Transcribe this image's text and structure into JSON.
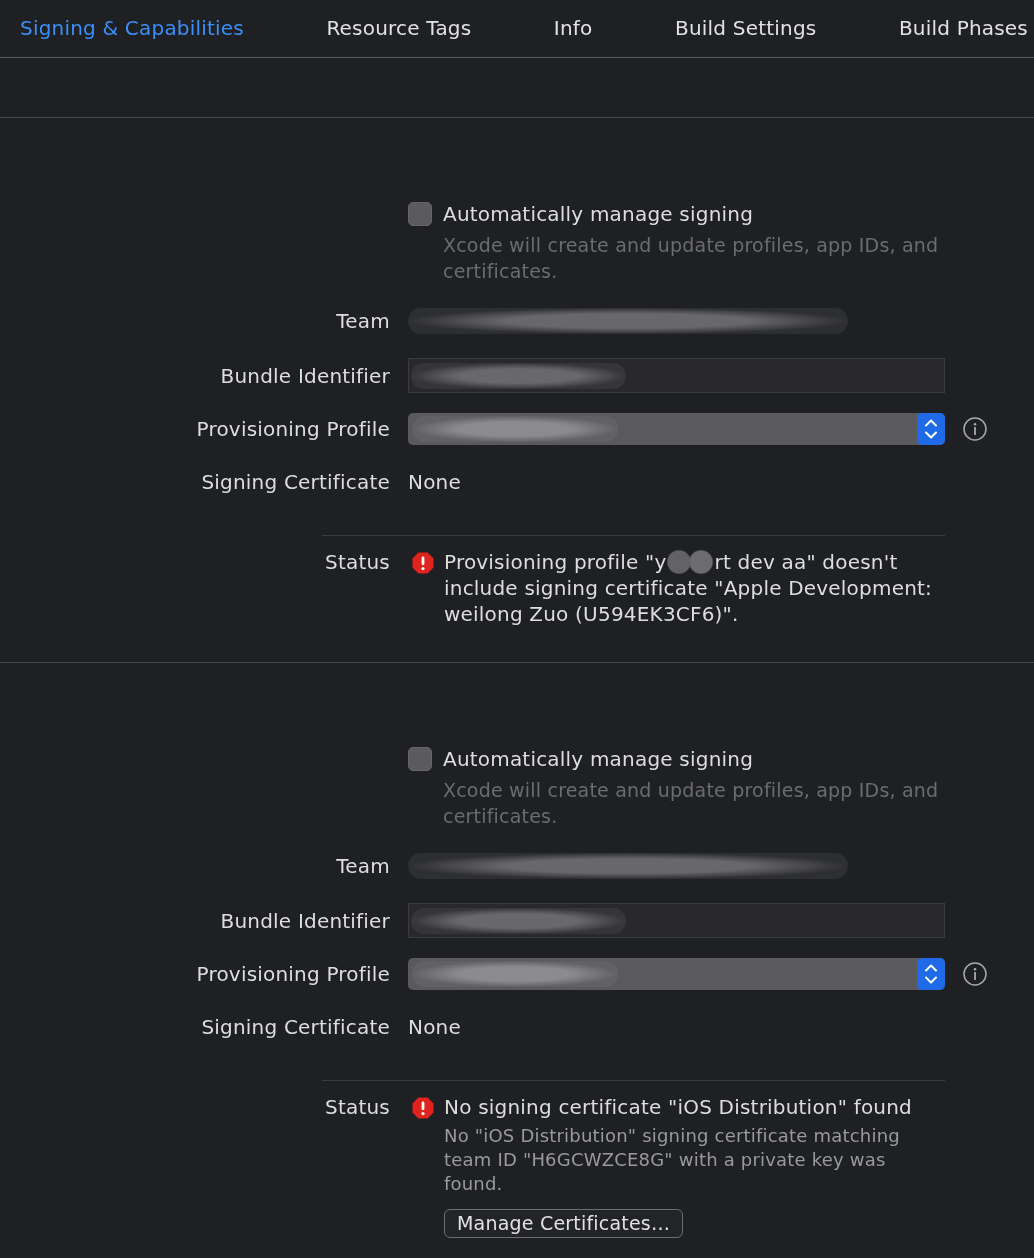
{
  "tabs": [
    {
      "label": "Signing & Capabilities",
      "selected": true
    },
    {
      "label": "Resource Tags",
      "selected": false
    },
    {
      "label": "Info",
      "selected": false
    },
    {
      "label": "Build Settings",
      "selected": false
    },
    {
      "label": "Build Phases",
      "selected": false
    }
  ],
  "sections": [
    {
      "auto_signing": {
        "label": "Automatically manage signing",
        "checked": false,
        "note": "Xcode will create and update profiles, app IDs, and certificates."
      },
      "fields": [
        {
          "kind": "text",
          "label": "Team",
          "redacted": true
        },
        {
          "kind": "input",
          "label": "Bundle Identifier",
          "redacted": true
        },
        {
          "kind": "popup",
          "label": "Provisioning Profile",
          "redacted": true
        },
        {
          "kind": "text",
          "label": "Signing Certificate",
          "value": "None"
        }
      ],
      "status": {
        "label": "Status",
        "kind": "error",
        "message_parts": [
          "Provisioning profile \"y",
          "rt dev aa\" doesn't include signing certificate \"Apple Development: weilong Zuo (U594EK3CF6)\"."
        ]
      }
    },
    {
      "auto_signing": {
        "label": "Automatically manage signing",
        "checked": false,
        "note": "Xcode will create and update profiles, app IDs, and certificates."
      },
      "fields": [
        {
          "kind": "text",
          "label": "Team",
          "redacted": true
        },
        {
          "kind": "input",
          "label": "Bundle Identifier",
          "redacted": true
        },
        {
          "kind": "popup",
          "label": "Provisioning Profile",
          "redacted": true
        },
        {
          "kind": "text",
          "label": "Signing Certificate",
          "value": "None"
        }
      ],
      "status": {
        "label": "Status",
        "kind": "error",
        "message_parts": [
          "No signing certificate \"iOS Distribution\" found"
        ],
        "detail": "No \"iOS Distribution\" signing certificate matching team ID \"H6GCWZCE8G\" with a private key was found.",
        "button": "Manage Certificates…"
      }
    }
  ]
}
